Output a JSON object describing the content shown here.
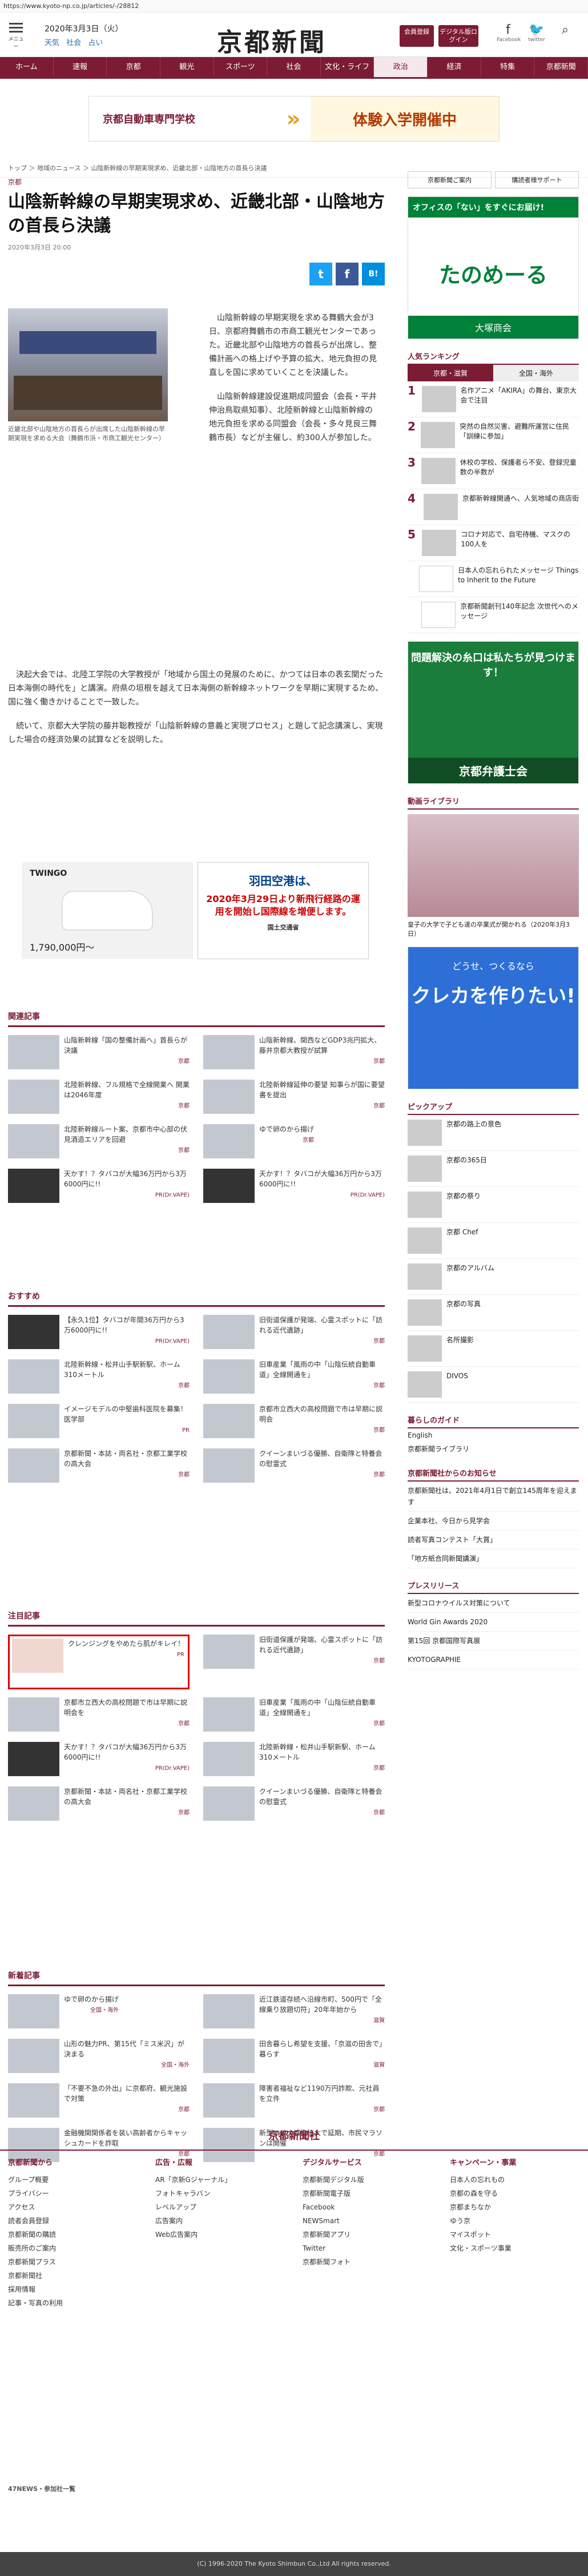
{
  "url": "https://www.kyoto-np.co.jp/articles/-/28812",
  "header": {
    "menu": "メニュー",
    "date": "2020年3月3日（火）",
    "weather": [
      "天気",
      "社会",
      "占い"
    ],
    "logo": "京都新聞",
    "btn_signup": "会員登録",
    "btn_digital": "デジタル版ログイン",
    "fb": "Facebook",
    "tw": "twitter"
  },
  "nav": [
    "ホーム",
    "速報",
    "京都",
    "観光",
    "スポーツ",
    "社会",
    "文化・ライフ",
    "政治",
    "経済",
    "特集",
    "京都新聞"
  ],
  "ad_top": {
    "left": "京都自動車専門学校",
    "right": "体験入学開催中"
  },
  "breadcrumb": "トップ ＞ 地域のニュース ＞ 山陰新幹線の早期実現求め、近畿北部・山陰地方の首長ら決議",
  "article": {
    "section": "京都",
    "title": "山陰新幹線の早期実現求め、近畿北部・山陰地方の首長ら決議",
    "date": "2020年3月3日 20:00",
    "caption": "近畿北部や山陰地方の首長らが出席した山陰新幹線の早期実現を求める大会（舞鶴市浜・市商工観光センター）",
    "p1": "山陰新幹線の早期実現を求める舞鶴大会が3日、京都府舞鶴市の市商工観光センターであった。近畿北部や山陰地方の首長らが出席し、整備計画への格上げや予算の拡大、地元負担の見直しを国に求めていくことを決議した。",
    "p2": "山陰新幹線建設促進期成同盟会（会長・平井伸治鳥取県知事）、北陸新幹線と山陰新幹線の地元負担を求める同盟会（会長・多々見良三舞鶴市長）などが主催し、約300人が参加した。",
    "p3": "決起大会では、北陸工学院の大学教授が「地域から国土の発展のために、かつては日本の表玄関だった日本海側の時代を」と講演。府県の垣根を越えて日本海側の新幹線ネットワークを早期に実現するため、国に強く働きかけることで一致した。",
    "p4": "続いて、京都大大学院の藤井聡教授が「山陰新幹線の意義と実現プロセス」と題して記念講演し、実現した場合の経済効果の試算などを説明した。"
  },
  "ad_mid": {
    "car": "TWINGO",
    "price": "1,790,000円〜",
    "air_title": "羽田空港は、",
    "air_body": "2020年3月29日より新飛行経路の運用を開始し国際線を増便します。",
    "air_org": "国土交通省"
  },
  "related": {
    "title": "関連記事",
    "items": [
      {
        "text": "山陰新幹線「国の整備計画へ」首長らが決議",
        "tag": "京都"
      },
      {
        "text": "山陰新幹線、関西などGDP3兆円拡大、藤井京都大教授が試算",
        "tag": "京都"
      },
      {
        "text": "北陸新幹線、フル規格で全線開業へ 開業は2046年度",
        "tag": "京都"
      },
      {
        "text": "北陸新幹線延伸の要望 知事らが国に要望書を提出",
        "tag": "京都"
      },
      {
        "text": "北陸新幹線ルート案、京都市中心部の伏見酒造エリアを回避",
        "tag": "京都"
      },
      {
        "text": "ゆで卵のから揚げ",
        "tag": "京都"
      },
      {
        "text": "天かす！？タバコが大幅36万円から3万6000円に!!",
        "tag": "PR(Dr.VAPE)"
      },
      {
        "text": "天かす！？タバコが大幅36万円から3万6000円に!!",
        "tag": "PR(Dr.VAPE)"
      }
    ]
  },
  "recommend": {
    "title": "おすすめ",
    "items": [
      {
        "text": "【永久1位】タバコが年間36万円から3万6000円に!!",
        "tag": "PR(Dr.VAPE)"
      },
      {
        "text": "旧街道保護が発端、心霊スポットに「訪れる近代遺跡」",
        "tag": "京都"
      },
      {
        "text": "北陸新幹線・松井山手駅新駅、ホーム310メートル",
        "tag": "京都"
      },
      {
        "text": "旧車産業「風雨の中「山陰伝統自動車道」全線開通を」",
        "tag": "京都"
      },
      {
        "text": "イメージモデルの中堅歯科医院を募集！医学部",
        "tag": "PR"
      },
      {
        "text": "京都市立西大の高校問題で市は早期に説明会",
        "tag": "京都"
      },
      {
        "text": "京都新聞・本誌・両名社・京都工業学校の高大会",
        "tag": "京都"
      },
      {
        "text": "クイーンまいづる優勝、自衛隊と特養会の慰霊式",
        "tag": "京都"
      }
    ]
  },
  "featured": {
    "title": "注目記事",
    "items": [
      {
        "text": "クレンジングをやめたら肌がキレイ！",
        "tag": "PR"
      },
      {
        "text": "旧街道保護が発端、心霊スポットに「訪れる近代遺跡」",
        "tag": "京都"
      },
      {
        "text": "京都市立西大の高校問題で市は早期に説明会を",
        "tag": "京都"
      },
      {
        "text": "旧車産業「風雨の中「山陰伝統自動車道」全線開通を」",
        "tag": "京都"
      },
      {
        "text": "天かす！？タバコが大幅36万円から3万6000円に!!",
        "tag": "PR(Dr.VAPE)"
      },
      {
        "text": "北陸新幹線・松井山手駅新駅、ホーム310メートル",
        "tag": "京都"
      },
      {
        "text": "京都新聞・本誌・両名社・京都工業学校の高大会",
        "tag": "京都"
      },
      {
        "text": "クイーンまいづる優勝、自衛隊と特養会の慰霊式",
        "tag": "京都"
      }
    ]
  },
  "latest": {
    "title": "新着記事",
    "items": [
      {
        "text": "ゆで卵のから揚げ",
        "tag": "全国・海外"
      },
      {
        "text": "近江鉄道存続へ沿線市町、500円で「全線乗り放題切符」20年年始から",
        "tag": "滋賀"
      },
      {
        "text": "山形の魅力PR、第15代「ミス米沢」が決まる",
        "tag": "全国・海外"
      },
      {
        "text": "田舎暮らし希望を支援、「京滋の田舎で」暮らす",
        "tag": "滋賀"
      },
      {
        "text": "「不要不急の外出」に京都府、観光施設で対策",
        "tag": "京都"
      },
      {
        "text": "障害者福祉など1190万円詐欺、元社員を立件",
        "tag": "京都"
      },
      {
        "text": "金融機関関係者を装い高齢者からキャッシュカードを詐取",
        "tag": "京都"
      },
      {
        "text": "新型コロナ感染拡大で延期、市民マラソンは開催",
        "tag": "京都"
      }
    ]
  },
  "sidebar": {
    "links": [
      "京都新聞ご案内",
      "購読者様サポート"
    ],
    "ad_title": "オフィスの「ない」をすぐにお届け!",
    "ad_brand": "たのめーる",
    "ad_company": "大塚商会",
    "ranking_title": "人気ランキング",
    "ranking_tabs": [
      "京都・滋賀",
      "全国・海外"
    ],
    "ranking": [
      {
        "text": "名作アニメ「AKIRA」の舞台、東京大会で注目",
        "tag": "京都"
      },
      {
        "text": "突然の自然災害、避難所運営に住民「訓練に参加」",
        "tag": "京都"
      },
      {
        "text": "休校の学校、保護者ら不安、登録児童数の半数が",
        "tag": "京都"
      },
      {
        "text": "京都新幹線開通へ、人気地域の商店街",
        "tag": "京都"
      },
      {
        "text": "コロナ対応で、自宅待機、マスクの100人を",
        "tag": "京都"
      },
      {
        "text": "日本人の忘れられたメッセージ Things to Inherit to the Future",
        "tag": "京都"
      },
      {
        "text": "京都新聞創刊140年記念 次世代へのメッセージ",
        "tag": "京都"
      }
    ],
    "ad2_title": "問題解決の糸口は私たちが見つけます！",
    "ad2_org": "京都弁護士会",
    "video_title": "動画ライブラリ",
    "video_caption": "皇子の大学で子ども達の卒業式が開かれる（2020年3月3日）",
    "ad3_title": "どうせ、つくるなら",
    "ad3_main": "クレカを作りたい!",
    "pickup_title": "ピックアップ",
    "pickup": [
      "京都の路上の景色",
      "京都の365日",
      "京都の祭り",
      "京都 Chef",
      "京都のアルバム",
      "京都の写真",
      "名所撮影",
      "DIVOS"
    ],
    "guide_title": "暮らしのガイド",
    "guide": [
      "English",
      "京都新聞ライブラリ"
    ],
    "notice_title": "京都新聞社からのお知らせ",
    "notices": [
      "京都新聞社は、2021年4月1日で創立145周年を迎えます",
      "企業本社、今日から見学会",
      "読者写真コンテスト「大賞」",
      "「地方紙合同新聞講演」"
    ],
    "press_title": "プレスリリース",
    "press": [
      "新型コロナウイルス対策について",
      "World Gin Awards 2020",
      "第15回 京都国際写真展",
      "KYOTOGRAPHIE"
    ]
  },
  "footer": {
    "logo": "京都新聞社",
    "cols": [
      {
        "title": "京都新聞から",
        "items": [
          "グループ概要",
          "プライバシー",
          "アクセス",
          "読者会員登録",
          "京都新聞の購読",
          "販売所のご案内",
          "京都新聞プラス",
          "京都新聞社",
          "採用情報",
          "記事・写真の利用"
        ]
      },
      {
        "title": "広告・広報",
        "items": [
          "AR「京新Gジャーナル」",
          "フォトキャラバン",
          "レベルアップ",
          "広告案内",
          "Web広告案内"
        ]
      },
      {
        "title": "デジタルサービス",
        "items": [
          "京都新聞デジタル版",
          "京都新聞電子版",
          "Facebook",
          "NEWSmart",
          "京都新聞アプリ",
          "Twitter",
          "京都新聞フォト"
        ]
      },
      {
        "title": "キャンペーン・事業",
        "items": [
          "日本人の忘れもの",
          "京都の森を守る",
          "京都まちなか",
          "ゆう京",
          "マイスポット",
          "文化・スポーツ事業"
        ]
      }
    ],
    "news_title": "47NEWS・参加社一覧",
    "copyright": "(C) 1996-2020 The Kyoto Shimbun Co.,Ltd All rights reserved."
  }
}
